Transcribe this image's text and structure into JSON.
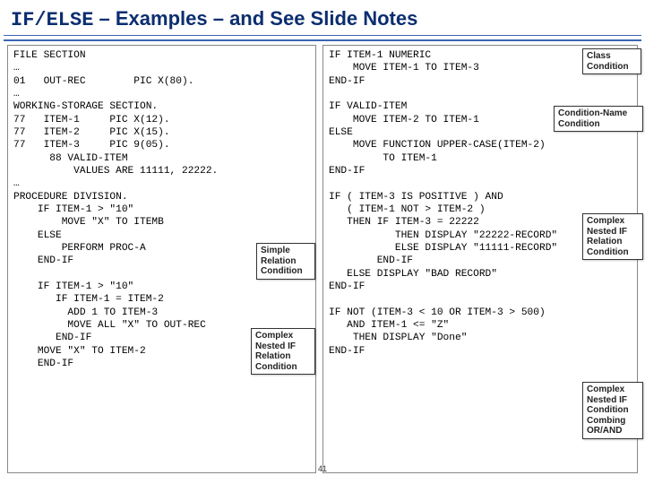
{
  "title_kw": "IF/ELSE",
  "title_rest": " – Examples – and See Slide Notes",
  "left_code": "FILE SECTION\n…\n01   OUT-REC        PIC X(80).\n…\nWORKING-STORAGE SECTION.\n77   ITEM-1     PIC X(12).\n77   ITEM-2     PIC X(15).\n77   ITEM-3     PIC 9(05).\n      88 VALID-ITEM\n          VALUES ARE 11111, 22222.\n…\nPROCEDURE DIVISION.\n    IF ITEM-1 > \"10\"\n        MOVE \"X\" TO ITEMB\n    ELSE\n        PERFORM PROC-A\n    END-IF\n\n    IF ITEM-1 > \"10\"\n       IF ITEM-1 = ITEM-2\n         ADD 1 TO ITEM-3\n         MOVE ALL \"X\" TO OUT-REC\n       END-IF\n    MOVE \"X\" TO ITEM-2\n    END-IF",
  "right_code": "IF ITEM-1 NUMERIC\n    MOVE ITEM-1 TO ITEM-3\nEND-IF\n\nIF VALID-ITEM\n    MOVE ITEM-2 TO ITEM-1\nELSE\n    MOVE FUNCTION UPPER-CASE(ITEM-2)\n         TO ITEM-1\nEND-IF\n\nIF ( ITEM-3 IS POSITIVE ) AND\n   ( ITEM-1 NOT > ITEM-2 )\n   THEN IF ITEM-3 = 22222\n           THEN DISPLAY \"22222-RECORD\"\n           ELSE DISPLAY \"11111-RECORD\"\n        END-IF\n   ELSE DISPLAY \"BAD RECORD\"\nEND-IF\n\nIF NOT (ITEM-3 < 10 OR ITEM-3 > 500)\n   AND ITEM-1 <= \"Z\"\n    THEN DISPLAY \"Done\"\nEND-IF",
  "labels": {
    "simple_relation": "Simple\nRelation\nCondition",
    "complex_nested_relation": "Complex\nNested IF\nRelation\nCondition",
    "class_condition": "Class\nCondition",
    "condition_name": "Condition-Name\nCondition",
    "complex_nested_if_relation": "Complex\nNested IF\nRelation\nCondition",
    "complex_combo": "Complex\nNested IF\nCondition\nCombing\nOR/AND"
  },
  "page_number": "41"
}
